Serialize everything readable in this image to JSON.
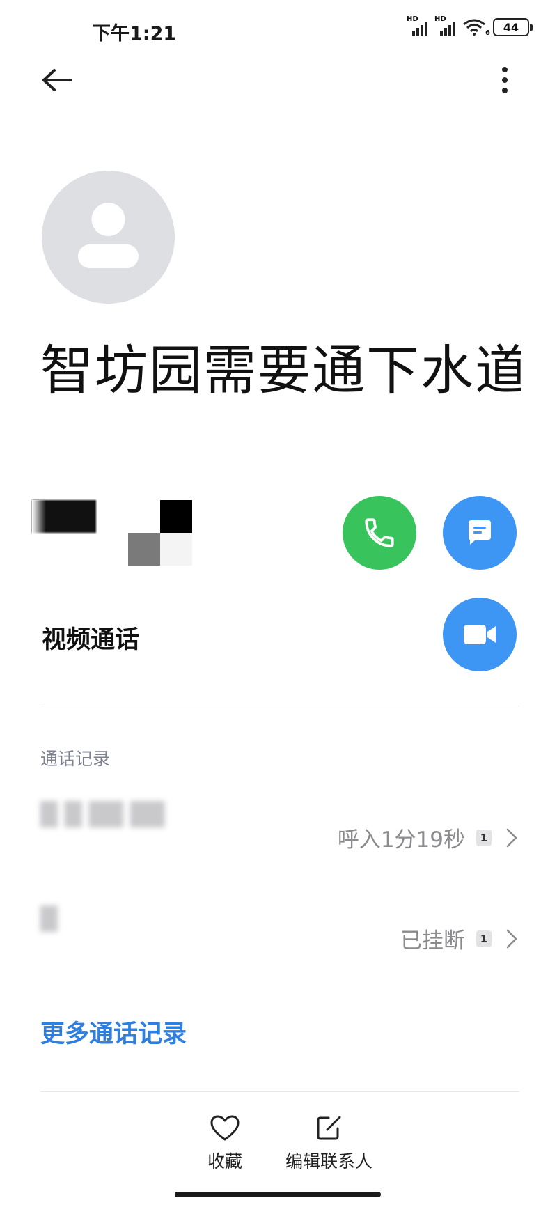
{
  "status_bar": {
    "time": "下午1:21",
    "signal1_label": "HD",
    "signal2_label": "HD",
    "wifi_label": "6",
    "battery": "44"
  },
  "header": {
    "back_icon": "arrow-left-icon",
    "more_icon": "more-vertical-icon"
  },
  "contact": {
    "avatar_icon": "person-placeholder-icon",
    "name": "智坊园需要通下水道"
  },
  "actions": {
    "call_icon": "phone-icon",
    "message_icon": "message-icon",
    "video_icon": "video-camera-icon",
    "video_label": "视频通话"
  },
  "call_log": {
    "title": "通话记录",
    "entries": [
      {
        "status": "呼入1分19秒",
        "sim": "1"
      },
      {
        "status": "已挂断",
        "sim": "1"
      }
    ],
    "more_link": "更多通话记录"
  },
  "bottom_bar": {
    "favorite_label": "收藏",
    "edit_label": "编辑联系人"
  },
  "colors": {
    "call_green": "#38c35c",
    "accent_blue": "#3d95f4",
    "link_blue": "#2f7fe0"
  }
}
